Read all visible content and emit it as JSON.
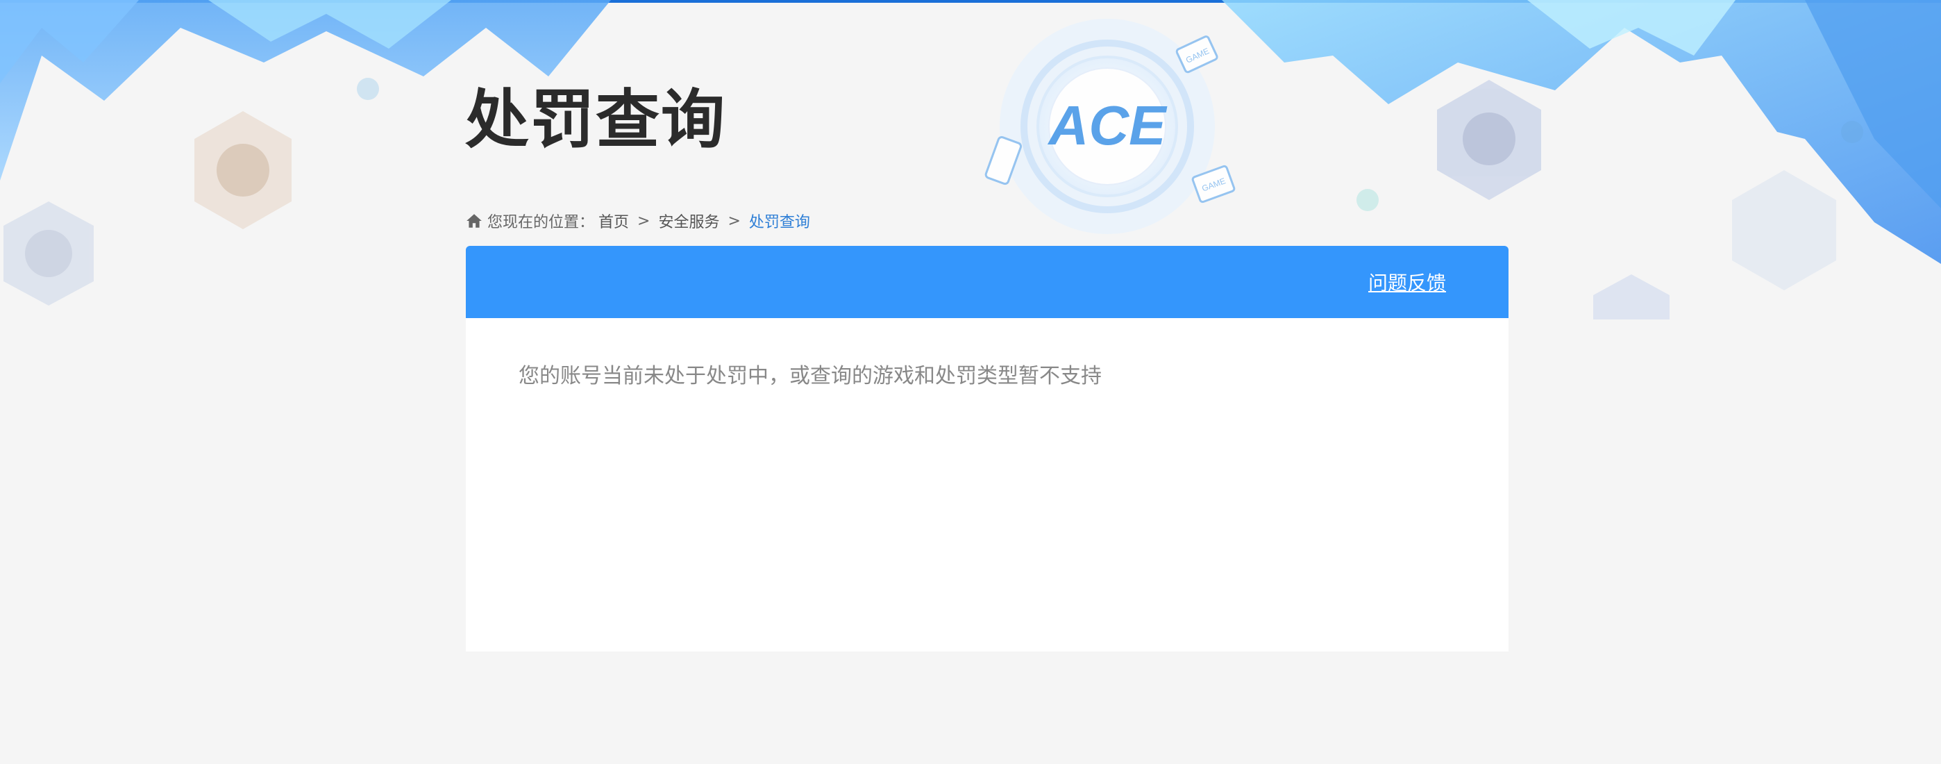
{
  "page": {
    "title": "处罚查询"
  },
  "breadcrumb": {
    "prefix": "您现在的位置：",
    "items": [
      "首页",
      "安全服务"
    ],
    "separator": ">",
    "current": "处罚查询"
  },
  "panel": {
    "feedback_label": "问题反馈",
    "notice": "您的账号当前未处于处罚中，或查询的游戏和处罚类型暂不支持"
  },
  "logo": {
    "text": "ACE",
    "badge_text": "GAME"
  },
  "colors": {
    "accent": "#3496fc",
    "link_current": "#2f7fd6",
    "title": "#2b2b2b",
    "background": "#f5f5f5"
  }
}
